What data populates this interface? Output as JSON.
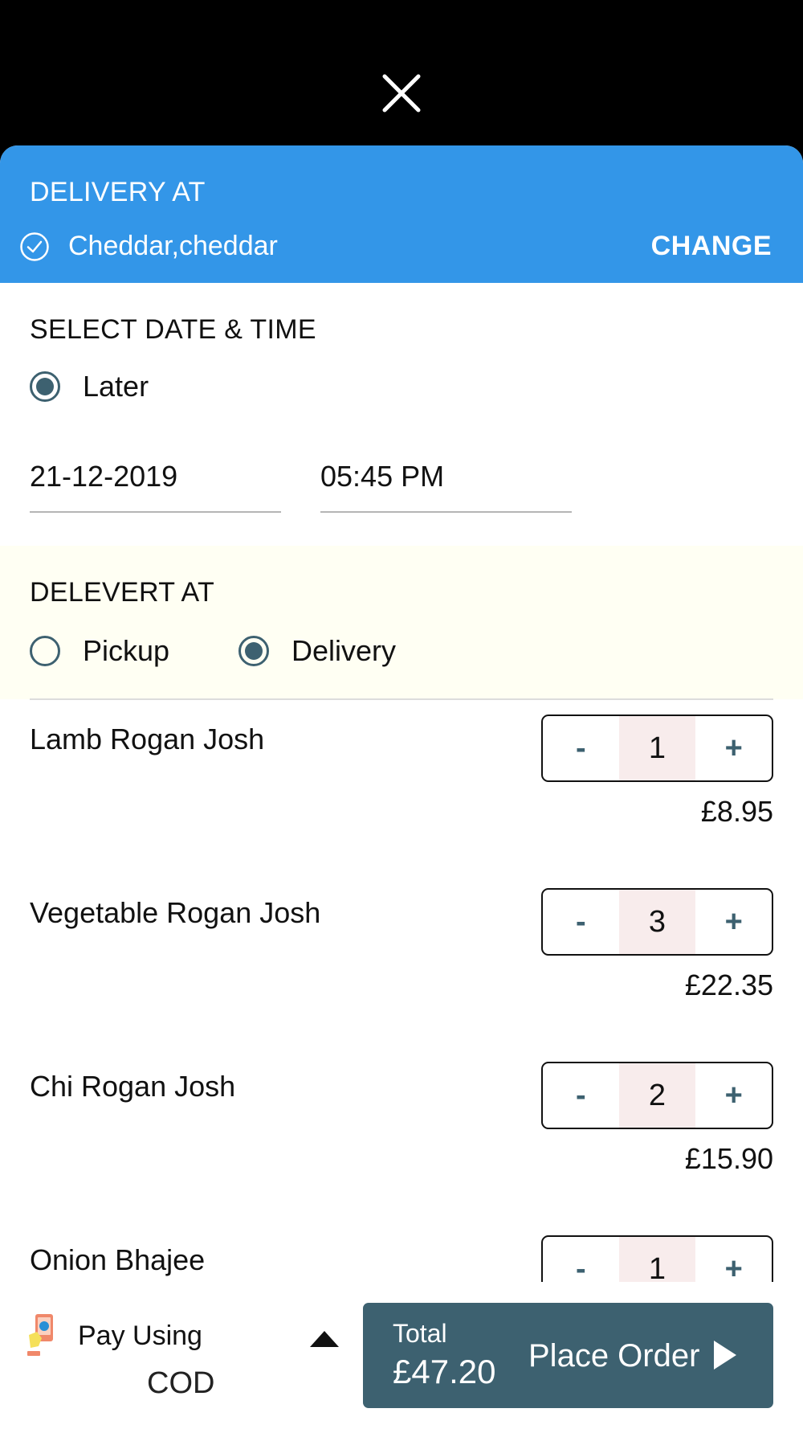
{
  "header": {
    "close_icon": "close-icon"
  },
  "delivery_at": {
    "title": "DELIVERY AT",
    "address": "Cheddar,cheddar",
    "change_label": "CHANGE",
    "bg_color": "#3396e8"
  },
  "schedule": {
    "title": "SELECT DATE & TIME",
    "option_label": "Later",
    "date": "21-12-2019",
    "time": "05:45 PM"
  },
  "order_type": {
    "title": "DELEVERT AT",
    "options": [
      {
        "label": "Pickup",
        "selected": false
      },
      {
        "label": "Delivery",
        "selected": true
      }
    ]
  },
  "items": [
    {
      "name": "Lamb Rogan Josh",
      "qty": "1",
      "price": "£8.95",
      "minus": "-",
      "plus": "+"
    },
    {
      "name": "Vegetable Rogan Josh",
      "qty": "3",
      "price": "£22.35",
      "minus": "-",
      "plus": "+"
    },
    {
      "name": "Chi Rogan Josh",
      "qty": "2",
      "price": "£15.90",
      "minus": "-",
      "plus": "+"
    },
    {
      "name": "Onion Bhajee",
      "qty": "1",
      "price": "",
      "minus": "-",
      "plus": "+"
    }
  ],
  "footer": {
    "pay_label": "Pay Using",
    "pay_method": "COD",
    "total_label": "Total",
    "total_value": "£47.20",
    "place_order_label": "Place Order",
    "accent_color": "#3d6170"
  }
}
